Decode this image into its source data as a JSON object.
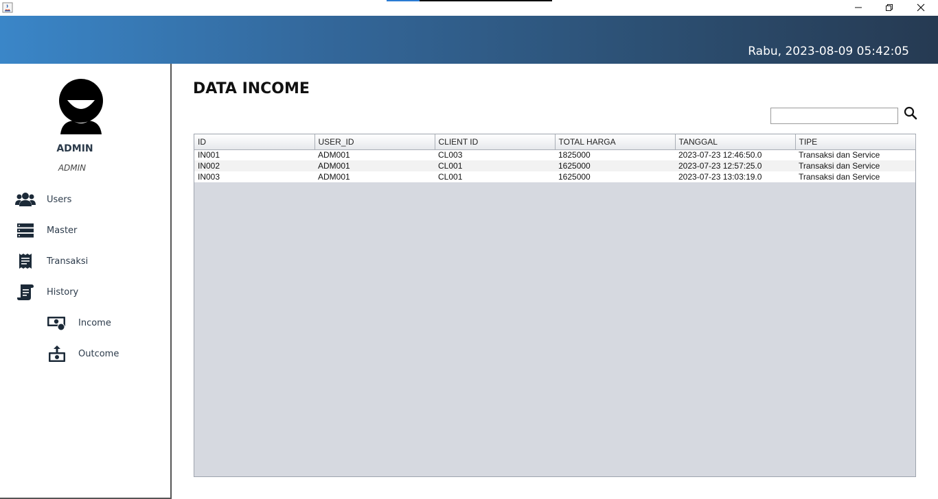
{
  "window": {
    "controls": [
      "minimize",
      "restore",
      "close"
    ]
  },
  "header": {
    "datetime": "Rabu, 2023-08-09 05:42:05"
  },
  "sidebar": {
    "user": {
      "name": "ADMIN",
      "role": "ADMIN"
    },
    "items": [
      {
        "label": "Users",
        "icon": "users-icon"
      },
      {
        "label": "Master",
        "icon": "server-list-icon"
      },
      {
        "label": "Transaksi",
        "icon": "receipt-icon"
      },
      {
        "label": "History",
        "icon": "scroll-icon"
      }
    ],
    "subitems": [
      {
        "label": "Income",
        "icon": "money-in-icon"
      },
      {
        "label": "Outcome",
        "icon": "money-out-icon"
      }
    ]
  },
  "main": {
    "title": "DATA INCOME",
    "search": {
      "value": "",
      "placeholder": ""
    },
    "table": {
      "columns": [
        "ID",
        "USER_ID",
        "CLIENT ID",
        "TOTAL HARGA",
        "TANGGAL",
        "TIPE"
      ],
      "rows": [
        [
          "IN001",
          "ADM001",
          "CL003",
          "1825000",
          "2023-07-23 12:46:50.0",
          "Transaksi dan Service"
        ],
        [
          "IN002",
          "ADM001",
          "CL001",
          "1625000",
          "2023-07-23 12:57:25.0",
          "Transaksi dan Service"
        ],
        [
          "IN003",
          "ADM001",
          "CL001",
          "1625000",
          "2023-07-23 13:03:19.0",
          "Transaksi dan Service"
        ]
      ]
    }
  },
  "colors": {
    "banner_start": "#3a86c8",
    "banner_end": "#263a52",
    "table_bg": "#d6d9e0",
    "sidebar_text": "#2b3a4a"
  }
}
